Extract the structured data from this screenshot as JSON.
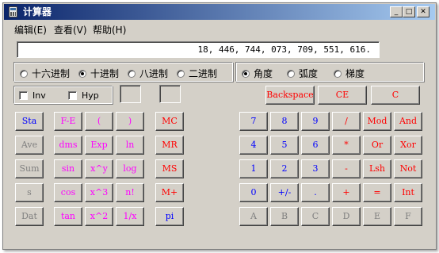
{
  "window": {
    "title": "计算器"
  },
  "title_buttons": {
    "minimize": "_",
    "maximize": "□",
    "close": "✕"
  },
  "menu": {
    "items": [
      "编辑(E)",
      "查看(V)",
      "帮助(H)"
    ]
  },
  "display": {
    "value": "18, 446, 744, 073, 709, 551, 616."
  },
  "base": {
    "options": [
      "十六进制",
      "十进制",
      "八进制",
      "二进制"
    ],
    "selected": "十进制"
  },
  "angle": {
    "options": [
      "角度",
      "弧度",
      "梯度"
    ],
    "selected": "角度"
  },
  "inv_label": "Inv",
  "hyp_label": "Hyp",
  "buttons": {
    "backspace": "Backspace",
    "ce": "CE",
    "c": "C",
    "stat": [
      "Sta",
      "Ave",
      "Sum",
      "s",
      "Dat"
    ],
    "sci1": [
      "F-E",
      "dms",
      "sin",
      "cos",
      "tan"
    ],
    "sci2": [
      "(",
      "Exp",
      "x^y",
      "x^3",
      "x^2"
    ],
    "sci3": [
      ")",
      "ln",
      "log",
      "n!",
      "1/x"
    ],
    "mem": [
      "MC",
      "MR",
      "MS",
      "M+",
      "pi"
    ],
    "num": [
      [
        "7",
        "8",
        "9",
        "/",
        "Mod",
        "And"
      ],
      [
        "4",
        "5",
        "6",
        "*",
        "Or",
        "Xor"
      ],
      [
        "1",
        "2",
        "3",
        "-",
        "Lsh",
        "Not"
      ],
      [
        "0",
        "+/-",
        ".",
        "+",
        "=",
        "Int"
      ],
      [
        "A",
        "B",
        "C",
        "D",
        "E",
        "F"
      ]
    ]
  }
}
